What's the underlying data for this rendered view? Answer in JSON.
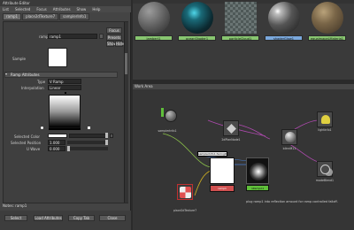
{
  "attribute_editor": {
    "title": "Attribute Editor",
    "menu": [
      "List",
      "Selected",
      "Focus",
      "Attributes",
      "Show",
      "Help"
    ],
    "tabs": [
      "ramp1",
      "place2dTexture7",
      "samplerInfo1"
    ],
    "ramp_label": "ramp:",
    "ramp_value": "ramp1",
    "focus_btn": "Focus",
    "presets_btn": "Presets",
    "show_btn": "Show",
    "hide_btn": "Hide",
    "sample_label": "Sample",
    "section_title": "Ramp Attributes",
    "type_label": "Type",
    "type_value": "V Ramp",
    "interp_label": "Interpolation",
    "interp_value": "Linear",
    "selected_color_label": "Selected Color",
    "selected_position_label": "Selected Position",
    "selected_position_value": "1.000",
    "u_wave_label": "U Wave",
    "u_wave_value": "0.000",
    "notes_label": "Notes: ramp1",
    "buttons": [
      "Select",
      "Load Attributes",
      "Copy Tab",
      "Close"
    ]
  },
  "hypershade": {
    "swatches": [
      {
        "label": "lambert1",
        "color": "#5f5f5f"
      },
      {
        "label": "oceanShader1",
        "color": "#1a4a55"
      },
      {
        "label": "particleCloud1",
        "color": "#9aa7a5"
      },
      {
        "label": "shaderGlow1",
        "color": "#404040"
      },
      {
        "label": "equalmapeLMateria1",
        "color": "#6a5a42"
      }
    ],
    "work_area_title": "Work Area",
    "connection_label": "samplerInfo1.facingRatio → ramp1.vCoord",
    "info_text": "plug ramp1 into reflection amount for ramp controlled falloff.",
    "nodes": {
      "samplerInfo": "samplerInfo1",
      "ramp": "ramp1",
      "place2d": "place2dTexture7",
      "bump": "nRampA1",
      "glow": "2dPlanNode1",
      "blinn": "blinnM11",
      "sg": "SG",
      "lightInfo": "lightInfo1",
      "mode": "modeBlend1"
    }
  }
}
